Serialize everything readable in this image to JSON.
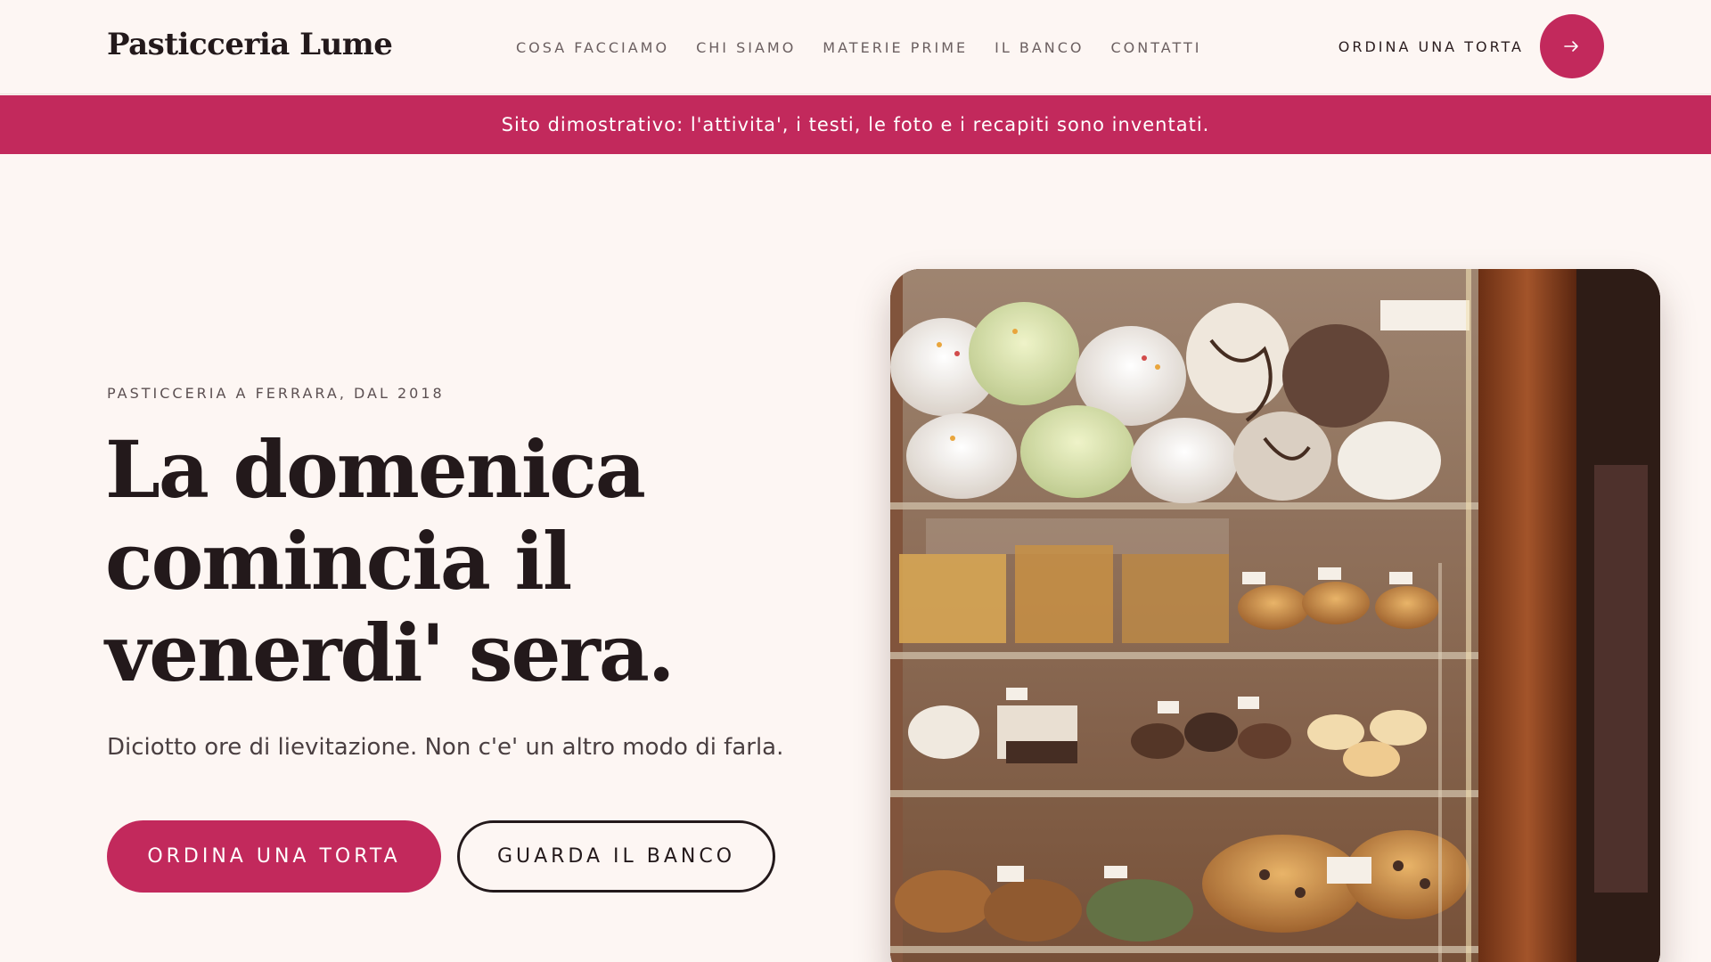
{
  "brand": {
    "name": "Pasticceria Lume"
  },
  "nav": {
    "items": [
      {
        "label": "COSA FACCIAMO"
      },
      {
        "label": "CHI SIAMO"
      },
      {
        "label": "MATERIE PRIME"
      },
      {
        "label": "IL BANCO"
      },
      {
        "label": "CONTATTI"
      }
    ],
    "cta_label": "ORDINA UNA TORTA",
    "cta_icon": "arrow-right-icon"
  },
  "banner": {
    "text": "Sito dimostrativo: l'attivita', i testi, le foto e i recapiti sono inventati."
  },
  "hero": {
    "eyebrow": "PASTICCERIA A FERRARA, DAL 2018",
    "headline_lines": [
      "La domenica",
      "comincia il",
      "venerdi' sera."
    ],
    "subtitle": "Diciotto ore di lievitazione. Non c'e' un altro modo di farla.",
    "primary_button": "ORDINA UNA TORTA",
    "secondary_button": "GUARDA IL BANCO",
    "image_subject": "pastry display case with meringues, biscuits, cannoli and panettone"
  },
  "colors": {
    "accent": "#c2295c",
    "background": "#fdf6f3",
    "text_dark": "#23191b"
  }
}
